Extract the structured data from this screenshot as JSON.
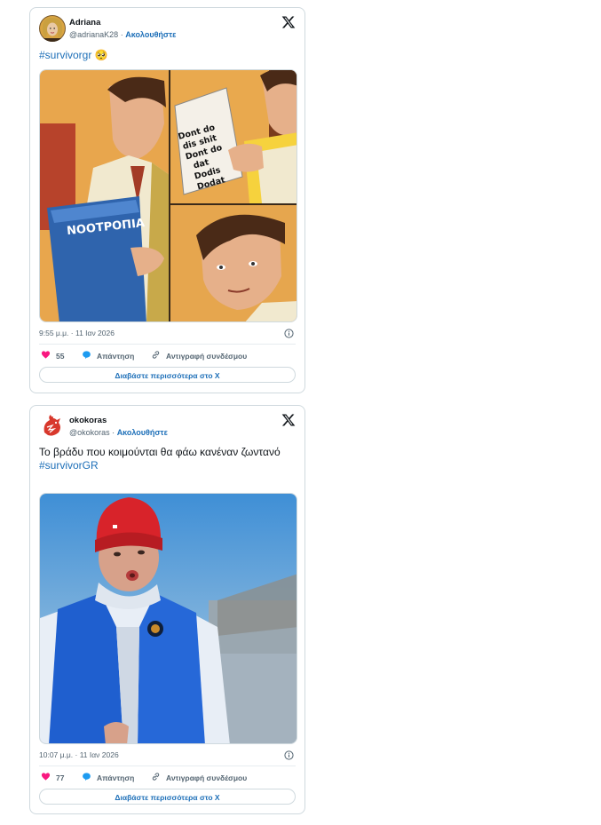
{
  "tweets": [
    {
      "author_name": "Adriana",
      "handle": "@adrianaK28",
      "separator": "·",
      "follow_label": "Ακολουθήστε",
      "text": "",
      "hashtag": "#survivorgr",
      "emoji": "🥺",
      "meme_book_title": "ΝΟΟΤΡΟΠΙΑ",
      "meme_page_text": "Dont do dis shit Dont do dat Dodis Dodat",
      "timestamp": "9:55 μ.μ. · 11 Ιαν 2026",
      "likes": "55",
      "reply_label": "Απάντηση",
      "copy_link_label": "Αντιγραφή συνδέσμου",
      "read_more_label": "Διαβάστε περισσότερα στο X"
    },
    {
      "author_name": "okokoras",
      "handle": "@okokoras",
      "separator": "·",
      "follow_label": "Ακολουθήστε",
      "text": "Το βράδυ που κοιμούνται θα φάω κανέναν ζωντανό",
      "hashtag": "#survivorGR",
      "emoji": "",
      "timestamp": "10:07 μ.μ. · 11 Ιαν 2026",
      "likes": "77",
      "reply_label": "Απάντηση",
      "copy_link_label": "Αντιγραφή συνδέσμου",
      "read_more_label": "Διαβάστε περισσότερα στο X"
    }
  ],
  "colors": {
    "link": "#1d6fb8",
    "like": "#f91880",
    "reply": "#1d9bf0",
    "muted": "#536471",
    "border": "#cfd9de"
  },
  "icons": [
    "x-logo-icon",
    "heart-icon",
    "reply-bubble-icon",
    "link-icon",
    "info-icon"
  ]
}
